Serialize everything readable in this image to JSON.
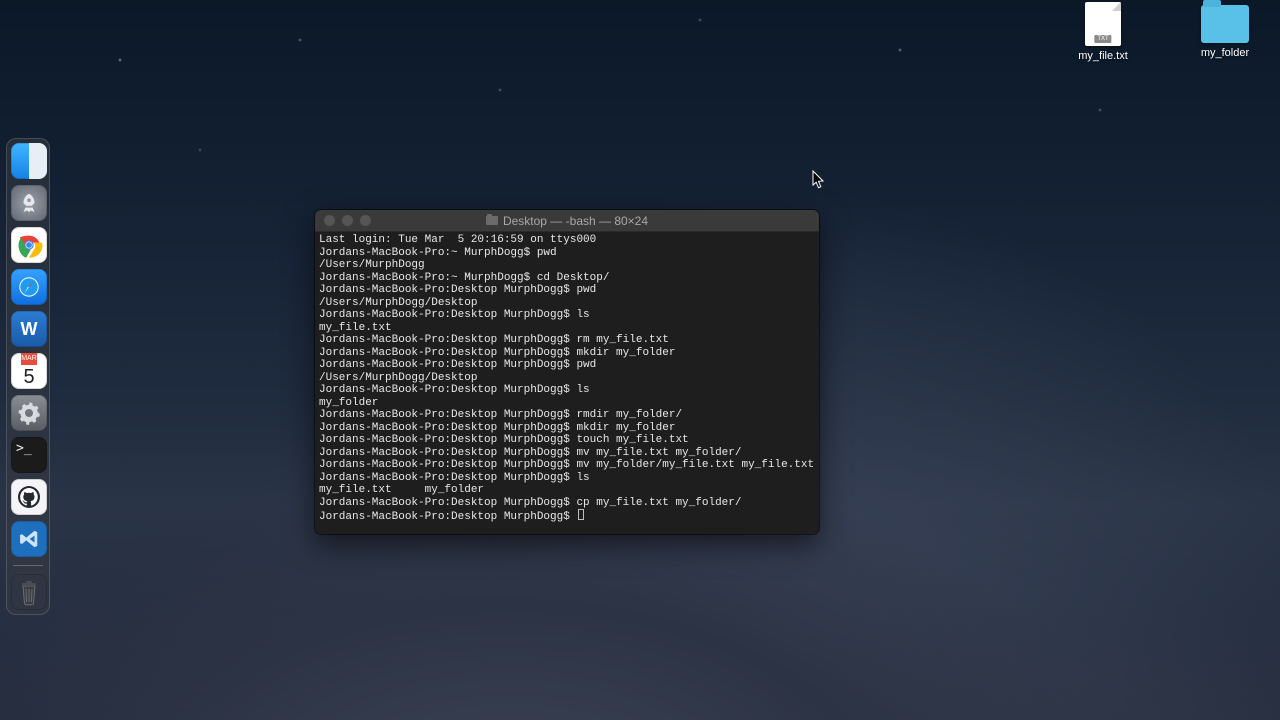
{
  "desktop": {
    "files": [
      {
        "type": "txt",
        "label": "my_file.txt",
        "badge": "TXT"
      },
      {
        "type": "folder",
        "label": "my_folder"
      }
    ]
  },
  "dock": {
    "items": [
      {
        "name": "finder",
        "label": "Finder"
      },
      {
        "name": "launchpad",
        "label": "Launchpad"
      },
      {
        "name": "chrome",
        "label": "Google Chrome"
      },
      {
        "name": "safari",
        "label": "Safari"
      },
      {
        "name": "word",
        "label": "Microsoft Word",
        "glyph": "W"
      },
      {
        "name": "calendar",
        "label": "Calendar",
        "month": "MAR",
        "day": "5"
      },
      {
        "name": "settings",
        "label": "System Preferences"
      },
      {
        "name": "terminal",
        "label": "Terminal",
        "glyph": ">_"
      },
      {
        "name": "github",
        "label": "GitHub Desktop"
      },
      {
        "name": "vscode",
        "label": "Visual Studio Code"
      }
    ],
    "trash": {
      "name": "trash",
      "label": "Trash"
    }
  },
  "terminal": {
    "title": "Desktop — -bash — 80×24",
    "last_login": "Last login: Tue Mar  5 20:16:59 on ttys000",
    "host": "Jordans-MacBook-Pro",
    "user": "MurphDogg",
    "home_path": "/Users/MurphDogg",
    "desktop_path": "/Users/MurphDogg/Desktop",
    "lines": [
      "Last login: Tue Mar  5 20:16:59 on ttys000",
      "Jordans-MacBook-Pro:~ MurphDogg$ pwd",
      "/Users/MurphDogg",
      "Jordans-MacBook-Pro:~ MurphDogg$ cd Desktop/",
      "Jordans-MacBook-Pro:Desktop MurphDogg$ pwd",
      "/Users/MurphDogg/Desktop",
      "Jordans-MacBook-Pro:Desktop MurphDogg$ ls",
      "my_file.txt",
      "Jordans-MacBook-Pro:Desktop MurphDogg$ rm my_file.txt",
      "Jordans-MacBook-Pro:Desktop MurphDogg$ mkdir my_folder",
      "Jordans-MacBook-Pro:Desktop MurphDogg$ pwd",
      "/Users/MurphDogg/Desktop",
      "Jordans-MacBook-Pro:Desktop MurphDogg$ ls",
      "my_folder",
      "Jordans-MacBook-Pro:Desktop MurphDogg$ rmdir my_folder/",
      "Jordans-MacBook-Pro:Desktop MurphDogg$ mkdir my_folder",
      "Jordans-MacBook-Pro:Desktop MurphDogg$ touch my_file.txt",
      "Jordans-MacBook-Pro:Desktop MurphDogg$ mv my_file.txt my_folder/",
      "Jordans-MacBook-Pro:Desktop MurphDogg$ mv my_folder/my_file.txt my_file.txt",
      "Jordans-MacBook-Pro:Desktop MurphDogg$ ls",
      "my_file.txt     my_folder",
      "Jordans-MacBook-Pro:Desktop MurphDogg$ cp my_file.txt my_folder/",
      "Jordans-MacBook-Pro:Desktop MurphDogg$ "
    ]
  }
}
